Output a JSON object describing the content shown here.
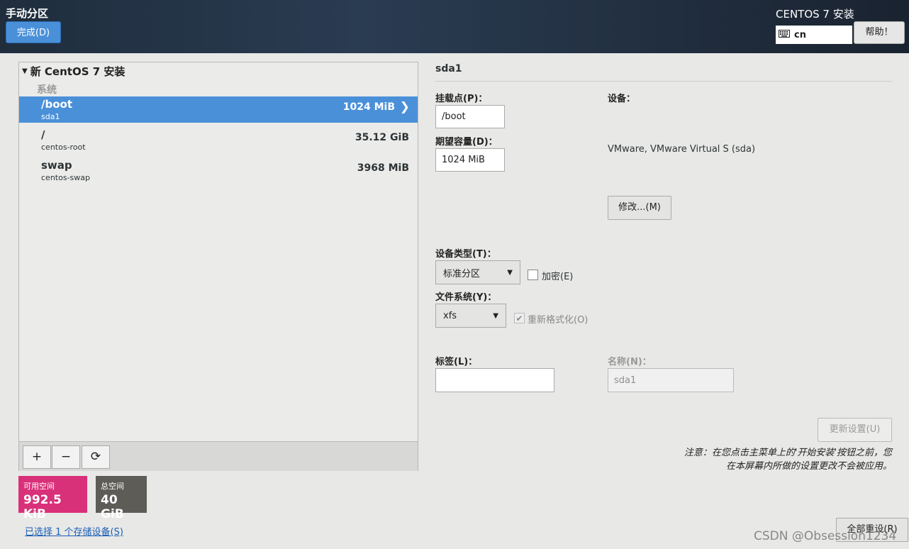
{
  "header": {
    "title": "手动分区",
    "done_label": "完成(D)",
    "product": "CENTOS 7 安装",
    "keyboard_layout": "cn",
    "help_label": "帮助！"
  },
  "left": {
    "tree_title": "新 CentOS 7 安装",
    "group_label": "系统",
    "partitions": [
      {
        "mount": "/boot",
        "device": "sda1",
        "size": "1024 MiB",
        "selected": true
      },
      {
        "mount": "/",
        "device": "centos-root",
        "size": "35.12 GiB",
        "selected": false
      },
      {
        "mount": "swap",
        "device": "centos-swap",
        "size": "3968 MiB",
        "selected": false
      }
    ],
    "toolbar": {
      "add": "+",
      "remove": "−",
      "refresh": "⟳"
    }
  },
  "space": {
    "available_label": "可用空间",
    "available_value": "992.5 KiB",
    "available_color": "#d9307a",
    "total_label": "总空间",
    "total_value": "40 GiB",
    "total_color": "#5e5c57"
  },
  "storage_link": "已选择 1 个存储设备(S)",
  "detail": {
    "title": "sda1",
    "mount_point_label": "挂载点(P)：",
    "mount_point_value": "/boot",
    "capacity_label": "期望容量(D)：",
    "capacity_value": "1024 MiB",
    "device_label": "设备：",
    "device_value": "VMware, VMware Virtual S (sda)",
    "modify_label": "修改...(M)",
    "device_type_label": "设备类型(T)：",
    "device_type_value": "标准分区",
    "encrypt_label": "加密(E)",
    "encrypt_checked": false,
    "fs_label": "文件系统(Y)：",
    "fs_value": "xfs",
    "reformat_label": "重新格式化(O)",
    "reformat_checked": true,
    "tag_label": "标签(L)：",
    "tag_value": "",
    "name_label": "名称(N)：",
    "name_value": "sda1",
    "update_label": "更新设置(U)",
    "note_line1": "注意：在您点击主菜单上的'开始安装'按钮之前，您",
    "note_line2": "在本屏幕内所做的设置更改不会被应用。",
    "reset_label": "全部重设(R)"
  },
  "watermark": "CSDN @Obsession1234"
}
